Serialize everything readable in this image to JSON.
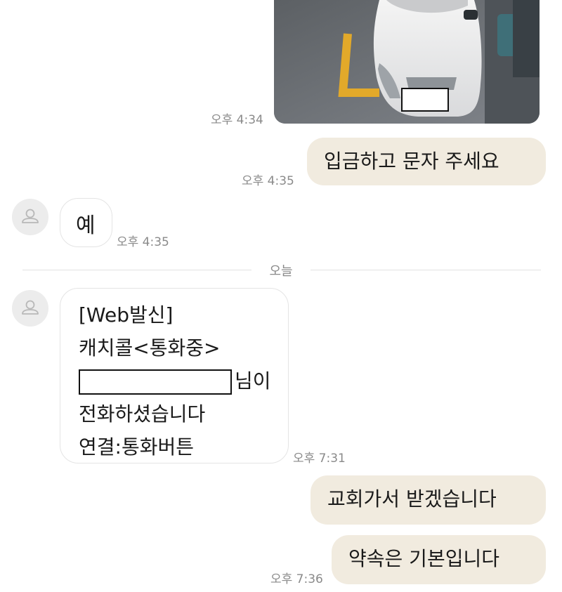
{
  "messages": {
    "photo_time": "오후 4:34",
    "out1": {
      "text": "입금하고 문자 주세요",
      "time": "오후 4:35"
    },
    "in1": {
      "text": "예",
      "time": "오후 4:35"
    },
    "divider": "오늘",
    "in2": {
      "lines": [
        "[Web발신]",
        "캐치콜<통화중>",
        "님이",
        "전화하셨습니다",
        "연결:통화버튼"
      ],
      "time": "오후 7:31"
    },
    "out2": {
      "text": "교회가서 받겠습니다"
    },
    "out3": {
      "text": "약속은 기본입니다",
      "time": "오후 7:36"
    }
  },
  "icons": {
    "avatar": "person-icon"
  },
  "colors": {
    "outgoing_bubble": "#f1ebdf",
    "incoming_bubble": "#ffffff",
    "timestamp": "#8a8a8a"
  }
}
